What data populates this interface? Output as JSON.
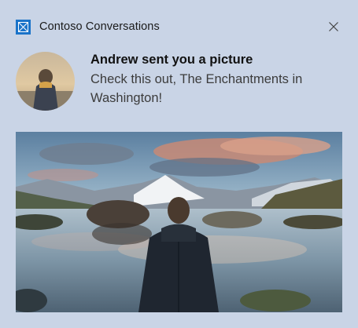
{
  "app": {
    "name": "Contoso Conversations",
    "icon": "app-logo-icon",
    "accent_color": "#1a73c9"
  },
  "header": {
    "close_icon": "close-icon"
  },
  "notification": {
    "title": "Andrew sent you a picture",
    "body": "Check this out, The Enchantments in Washington!"
  },
  "avatar": {
    "icon": "avatar"
  },
  "hero_image": {
    "icon": "hero-image"
  }
}
